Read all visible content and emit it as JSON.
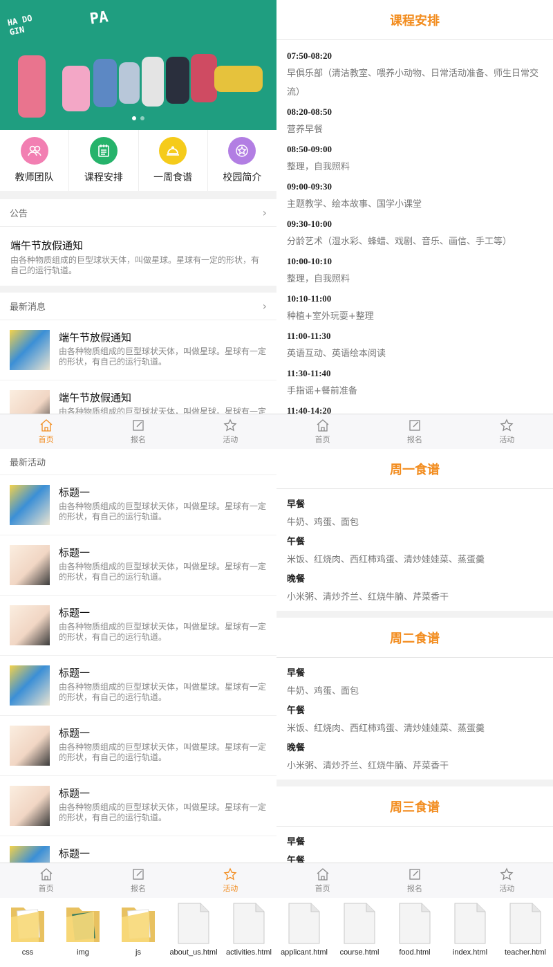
{
  "colors": {
    "accent": "#f28c1e",
    "teacher": "#f27fb2",
    "course": "#26b36b",
    "food": "#f5cb1b",
    "campus": "#b27ee3",
    "hero_bg": "#1f9e80"
  },
  "hero": {
    "doodle_left": "HA DO GIN",
    "doodle_right": "PA"
  },
  "quick_nav": [
    {
      "label": "教师团队",
      "icon": "people-icon"
    },
    {
      "label": "课程安排",
      "icon": "notepad-icon"
    },
    {
      "label": "一周食谱",
      "icon": "cloche-icon"
    },
    {
      "label": "校园简介",
      "icon": "star-icon"
    }
  ],
  "announcement": {
    "heading": "公告",
    "title": "端午节放假通知",
    "desc": "由各种物质组成的巨型球状天体，叫做星球。星球有一定的形状，有自己的运行轨道。"
  },
  "news": {
    "heading": "最新消息",
    "items": [
      {
        "title": "端午节放假通知",
        "desc": "由各种物质组成的巨型球状天体，叫做星球。星球有一定的形状，有自己的运行轨道。"
      },
      {
        "title": "端午节放假通知",
        "desc": "由各种物质组成的巨型球状天体，叫做星球。星球有一定的形状，有自己的运行轨道。"
      }
    ]
  },
  "tabs": {
    "home": "首页",
    "signup": "报名",
    "activity": "活动"
  },
  "course": {
    "title": "课程安排",
    "schedule": [
      {
        "time": "07:50-08:20",
        "activity": "早俱乐部（清洁教室、喂养小动物、日常活动准备、师生日常交流）"
      },
      {
        "time": "08:20-08:50",
        "activity": "营养早餐"
      },
      {
        "time": "08:50-09:00",
        "activity": "整理，自我照料"
      },
      {
        "time": "09:00-09:30",
        "activity": "主题教学、绘本故事、国学小课堂"
      },
      {
        "time": "09:30-10:00",
        "activity": "分龄艺术（湿水彩、蜂蜡、戏剧、音乐、画信、手工等）"
      },
      {
        "time": "10:00-10:10",
        "activity": "整理，自我照料"
      },
      {
        "time": "10:10-11:00",
        "activity": "种植+室外玩耍+整理"
      },
      {
        "time": "11:00-11:30",
        "activity": "英语互动、英语绘本阅读"
      },
      {
        "time": "11:30-11:40",
        "activity": "手指谣+餐前准备"
      },
      {
        "time": "11:40-14:20",
        "activity": ""
      }
    ]
  },
  "activities": {
    "heading": "最新活动",
    "items": [
      {
        "title": "标题一",
        "desc": "由各种物质组成的巨型球状天体，叫做星球。星球有一定的形状，有自己的运行轨道。"
      },
      {
        "title": "标题一",
        "desc": "由各种物质组成的巨型球状天体，叫做星球。星球有一定的形状，有自己的运行轨道。"
      },
      {
        "title": "标题一",
        "desc": "由各种物质组成的巨型球状天体，叫做星球。星球有一定的形状，有自己的运行轨道。"
      },
      {
        "title": "标题一",
        "desc": "由各种物质组成的巨型球状天体，叫做星球。星球有一定的形状，有自己的运行轨道。"
      },
      {
        "title": "标题一",
        "desc": "由各种物质组成的巨型球状天体，叫做星球。星球有一定的形状，有自己的运行轨道。"
      },
      {
        "title": "标题一",
        "desc": "由各种物质组成的巨型球状天体，叫做星球。星球有一定的形状，有自己的运行轨道。"
      },
      {
        "title": "标题一",
        "desc": ""
      }
    ]
  },
  "food": {
    "meal_labels": {
      "breakfast": "早餐",
      "lunch": "午餐",
      "dinner": "晚餐"
    },
    "days": [
      {
        "title": "周一食谱",
        "breakfast": "牛奶、鸡蛋、面包",
        "lunch": "米饭、红烧肉、西红柿鸡蛋、清炒娃娃菜、蒸蛋羹",
        "dinner": "小米粥、清炒芥兰、红烧牛腩、芹菜香干"
      },
      {
        "title": "周二食谱",
        "breakfast": "牛奶、鸡蛋、面包",
        "lunch": "米饭、红烧肉、西红柿鸡蛋、清炒娃娃菜、蒸蛋羹",
        "dinner": "小米粥、清炒芥兰、红烧牛腩、芹菜香干"
      },
      {
        "title": "周三食谱",
        "breakfast": "",
        "lunch": "",
        "dinner": ""
      }
    ]
  },
  "files": [
    {
      "name": "css",
      "type": "folder"
    },
    {
      "name": "img",
      "type": "folder-image"
    },
    {
      "name": "js",
      "type": "folder"
    },
    {
      "name": "about_us.html",
      "type": "file"
    },
    {
      "name": "activities.html",
      "type": "file"
    },
    {
      "name": "applicant.html",
      "type": "file"
    },
    {
      "name": "course.html",
      "type": "file"
    },
    {
      "name": "food.html",
      "type": "file"
    },
    {
      "name": "index.html",
      "type": "file"
    },
    {
      "name": "teacher.html",
      "type": "file"
    }
  ]
}
